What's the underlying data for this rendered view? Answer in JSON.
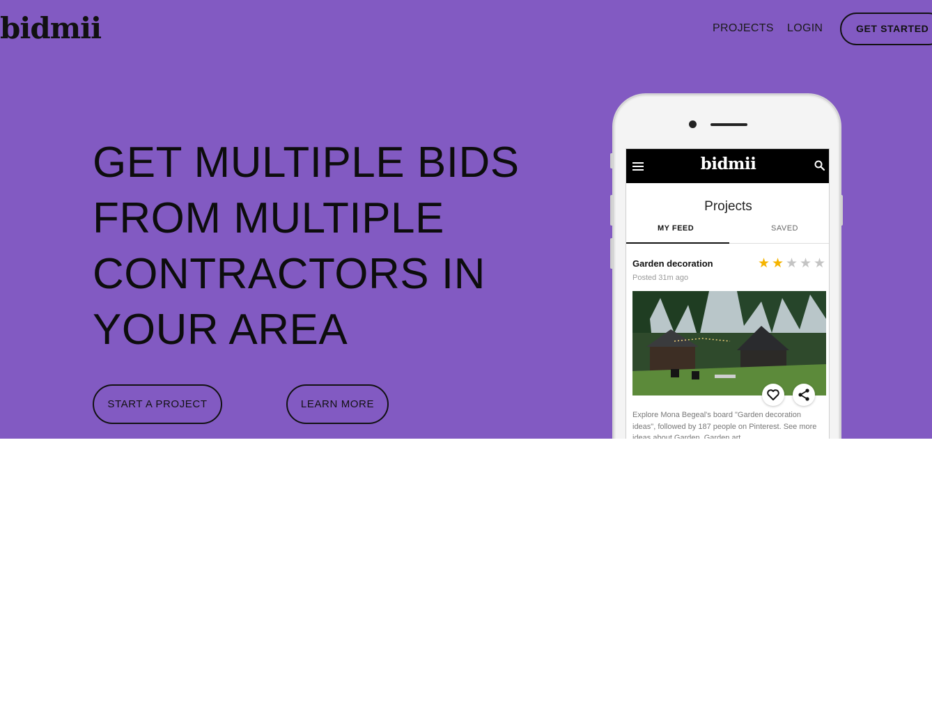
{
  "colors": {
    "hero_bg": "#825ac2",
    "text_dark": "#111111",
    "star_active": "#f5b400",
    "star_inactive": "#c4c4c4"
  },
  "header": {
    "logo": "bidmii",
    "nav": {
      "projects": "PROJECTS",
      "login": "LOGIN"
    },
    "get_started": "GET STARTED"
  },
  "hero": {
    "headline_lines": [
      "GET MULTIPLE BIDS",
      "FROM MULTIPLE",
      "CONTRACTORS IN",
      "YOUR AREA"
    ],
    "buttons": {
      "start_project": "START A PROJECT",
      "learn_more": "LEARN MORE"
    }
  },
  "phone": {
    "app_bar": {
      "logo": "bidmii",
      "menu_icon": "hamburger-menu-icon",
      "search_icon": "search-icon"
    },
    "title": "Projects",
    "tabs": {
      "active": "MY FEED",
      "inactive": "SAVED"
    },
    "card": {
      "title": "Garden decoration",
      "posted": "Posted 31m ago",
      "rating": 2,
      "rating_max": 5,
      "image_icon": "garden-photo",
      "actions": [
        "heart-icon",
        "share-icon"
      ],
      "description": "Explore Mona Begeal's board \"Garden decoration ideas\", followed by 187 people on Pinterest. See more ideas about Garden, Garden art..."
    }
  }
}
